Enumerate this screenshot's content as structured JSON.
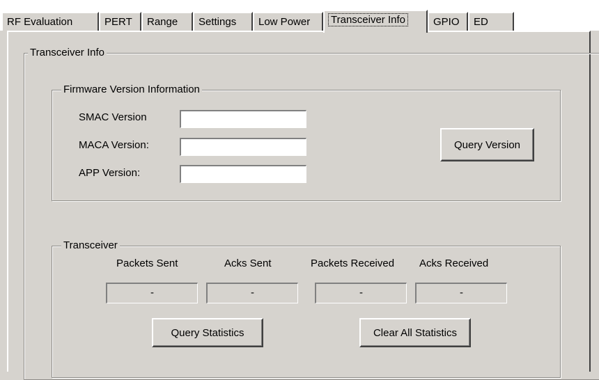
{
  "tabs": [
    {
      "label": "RF Evaluation"
    },
    {
      "label": "PERT"
    },
    {
      "label": "Range"
    },
    {
      "label": "Settings"
    },
    {
      "label": "Low Power"
    },
    {
      "label": "Transceiver Info",
      "active": true
    },
    {
      "label": "GPIO"
    },
    {
      "label": "ED"
    }
  ],
  "transceiver_info": {
    "title": "Transceiver Info",
    "firmware": {
      "title": "Firmware Version Information",
      "smac_label": "SMAC Version",
      "smac_value": "",
      "maca_label": "MACA Version:",
      "maca_value": "",
      "app_label": "APP Version:",
      "app_value": "",
      "query_button": "Query Version"
    },
    "transceiver": {
      "title": "Transceiver",
      "packets_sent_label": "Packets Sent",
      "acks_sent_label": "Acks Sent",
      "packets_received_label": "Packets Received",
      "acks_received_label": "Acks Received",
      "packets_sent_value": "-",
      "acks_sent_value": "-",
      "packets_received_value": "-",
      "acks_received_value": "-",
      "query_stats_button": "Query Statistics",
      "clear_stats_button": "Clear All Statistics"
    }
  }
}
